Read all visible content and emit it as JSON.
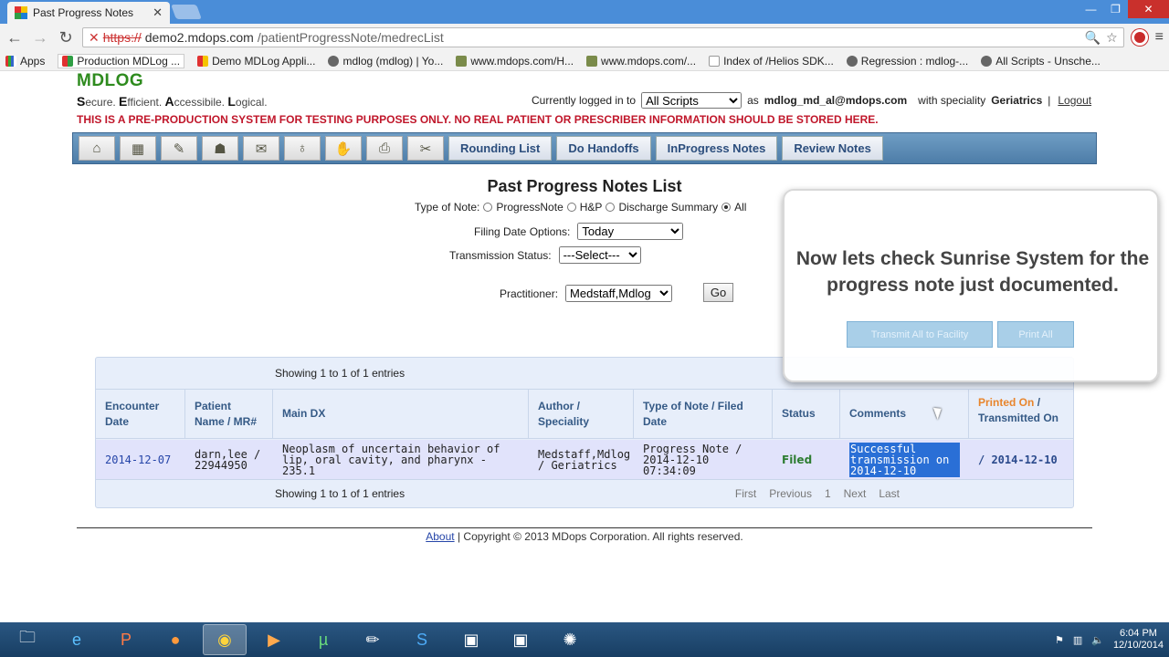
{
  "browser": {
    "tab_title": "Past Progress Notes",
    "tab_close": "✕",
    "url_scheme": "https://",
    "url_host": "demo2.mdops.com",
    "url_path": "/patientProgressNote/medrecList",
    "bookmarks": [
      "Apps",
      "Production MDLog ...",
      "Demo MDLog Appli...",
      "mdlog (mdlog) | Yo...",
      "www.mdops.com/H...",
      "www.mdops.com/...",
      "Index of /Helios SDK...",
      "Regression : mdlog-...",
      "All Scripts - Unsche..."
    ]
  },
  "app": {
    "logo": "MDLOG",
    "tagline": [
      {
        "initial": "S",
        "rest": "ecure. "
      },
      {
        "initial": "E",
        "rest": "fficient. "
      },
      {
        "initial": "A",
        "rest": "ccessibile. "
      },
      {
        "initial": "L",
        "rest": "ogical."
      }
    ],
    "login_prefix": "Currently logged in to",
    "login_system": "All Scripts",
    "login_as": "as",
    "login_user": "mdlog_md_al@mdops.com",
    "login_speciality_prefix": "with speciality",
    "login_speciality": "Geriatrics",
    "login_sep": "|",
    "logout": "Logout",
    "warning": "THIS IS A PRE-PRODUCTION SYSTEM FOR TESTING PURPOSES ONLY. NO REAL PATIENT OR PRESCRIBER INFORMATION SHOULD BE STORED HERE.",
    "menu_tabs": [
      "Rounding List",
      "Do Handoffs",
      "InProgress Notes",
      "Review Notes"
    ]
  },
  "page": {
    "title": "Past Progress Notes List",
    "type_label": "Type of Note:",
    "type_options": [
      "ProgressNote",
      "H&P",
      "Discharge Summary",
      "All"
    ],
    "type_selected": "All",
    "filing_label": "Filing Date Options:",
    "filing_value": "Today",
    "transmission_label": "Transmission Status:",
    "transmission_value": "---Select---",
    "practitioner_label": "Practitioner:",
    "practitioner_value": "Medstaff,Mdlog",
    "go": "Go"
  },
  "table": {
    "info": "Showing 1 to 1 of 1 entries",
    "headers": {
      "encounter": "Encounter Date",
      "patient": "Patient Name / MR#",
      "dx": "Main DX",
      "author": "Author / Speciality",
      "type": "Type of Note / Filed Date",
      "status": "Status",
      "comments": "Comments",
      "printed": "Printed On",
      "transmitted": "/ Transmitted On"
    },
    "row": {
      "encounter": "2014-12-07",
      "patient": "darn,lee / 22944950",
      "dx": "Neoplasm of uncertain behavior of lip, oral cavity, and pharynx - 235.1",
      "author": "Medstaff,Mdlog / Geriatrics",
      "type": "Progress Note / 2014-12-10 07:34:09",
      "status": "Filed",
      "comments": "Successful transmission on 2014-12-10",
      "transmitted": "/ 2014-12-10"
    },
    "pager": [
      "First",
      "Previous",
      "1",
      "Next",
      "Last"
    ]
  },
  "overlay": {
    "text": "Now lets check Sunrise System for the progress note just documented.",
    "btn_transmit": "Transmit All to Facility",
    "btn_print": "Print All"
  },
  "footer": {
    "about": "About",
    "copyright": "|  Copyright © 2013 MDops Corporation. All rights reserved."
  },
  "taskbar": {
    "time": "6:04 PM",
    "date": "12/10/2014"
  }
}
